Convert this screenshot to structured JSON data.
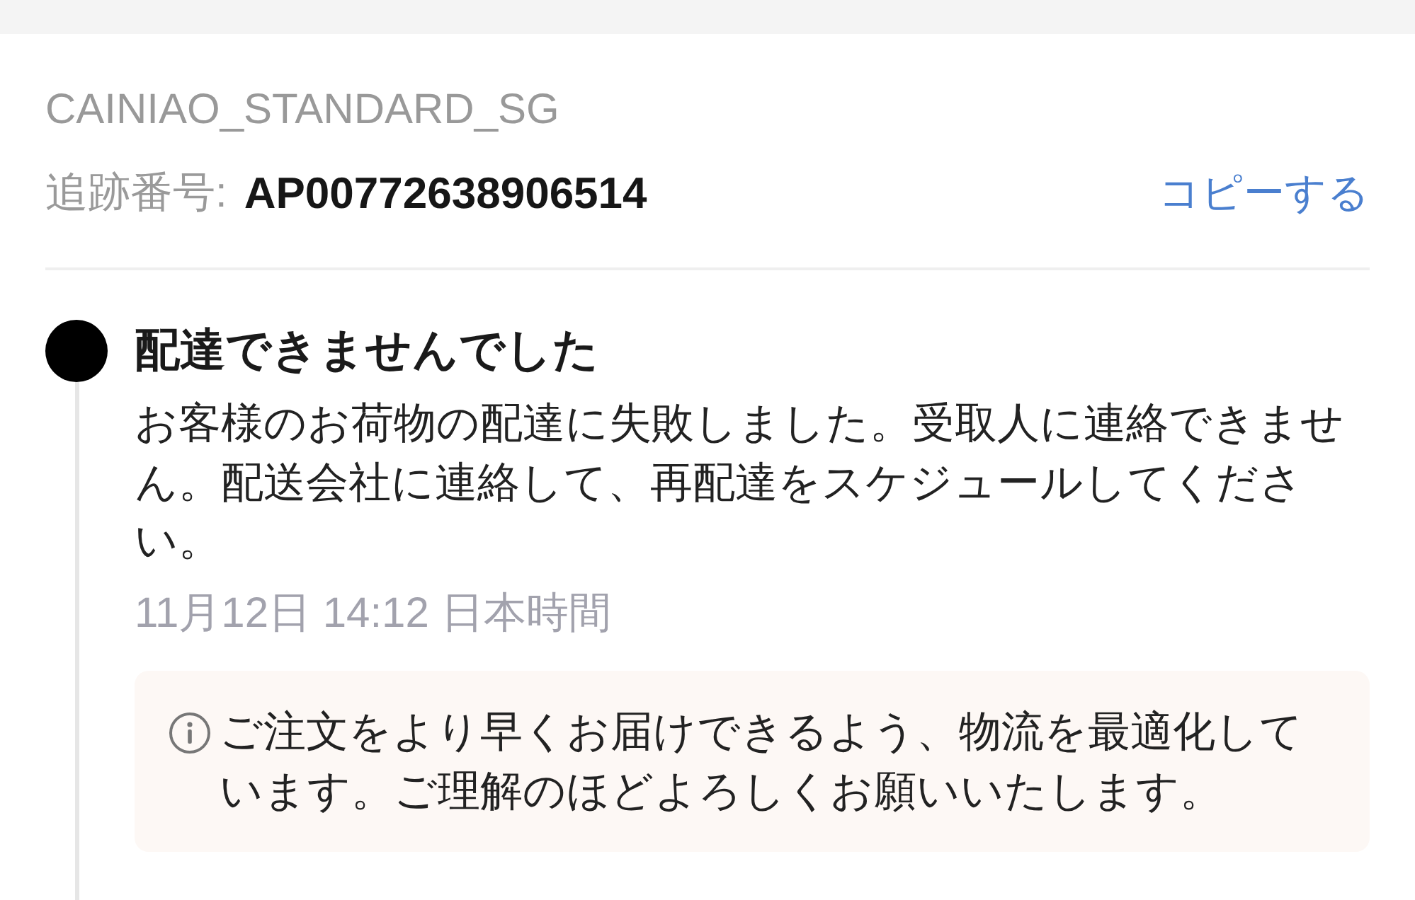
{
  "shipment": {
    "carrier": "CAINIAO_STANDARD_SG",
    "tracking_label": "追跡番号:",
    "tracking_number": "AP00772638906514",
    "copy_link": "コピーする"
  },
  "timeline": [
    {
      "current": true,
      "title": "配達できませんでした",
      "description": "お客様のお荷物の配達に失敗しました。受取人に連絡できません。配送会社に連絡して、再配達をスケジュールしてください。",
      "time": "11月12日 14:12 日本時間",
      "notice": "ご注文をより早くお届けできるよう、物流を最適化しています。ご理解のほどよろしくお願いいたします。"
    }
  ]
}
